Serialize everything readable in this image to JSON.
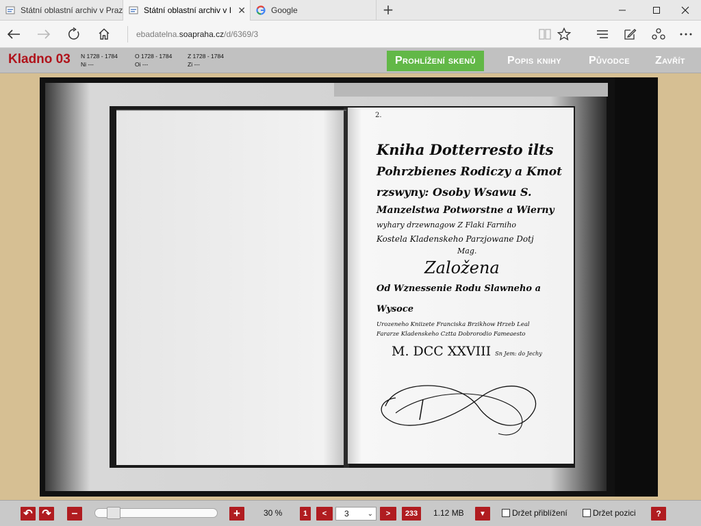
{
  "browser": {
    "tabs": [
      {
        "label": "Státní oblastní archiv v Praz",
        "active": false
      },
      {
        "label": "Státní oblastní archiv v I",
        "active": true
      },
      {
        "label": "Google",
        "active": false
      }
    ],
    "new_tab_symbol": "+",
    "url_prefix": "ebadatelna.",
    "url_host": "soapraha.cz",
    "url_path": "/d/6369/3"
  },
  "header": {
    "title": "Kladno 03",
    "meta": {
      "n": "N 1728 - 1784",
      "ni": "Ni ---",
      "o": "O 1728 - 1784",
      "oi": "Oi ---",
      "z": "Z 1728 - 1784",
      "zi": "Zi ---"
    },
    "menu": [
      {
        "label": "Prohlížení skenů",
        "active": true
      },
      {
        "label": "Popis knihy",
        "active": false
      },
      {
        "label": "Původce",
        "active": false
      },
      {
        "label": "Zavřít",
        "active": false
      }
    ]
  },
  "scan": {
    "page_number": "2.",
    "lines": [
      "Kniha Dotterresto ilts",
      "Pohrzbienes Rodiczy a Kmot",
      "rzswyny: Osoby Wsawu S.",
      "Manzelstwa Potworstne a Wierny",
      "wyhary drzewnagow Z Flaki Farniho",
      "Kostela Kladenskeho Parzjowane Dotj",
      "Mag.",
      "Založena",
      "Od Wznessenie Rodu Slawneho a Wysoce",
      "Urozeneho Kniizete Franciska Brzikhow Hrzeb Leal",
      "Fararze Kladenskeho Cztta Dobrorodio Fameaesto",
      "M. DCC XXVIII",
      "Sn Jem: do Jechy"
    ]
  },
  "toolbar": {
    "undo_symbol": "↶",
    "redo_symbol": "↷",
    "minus": "–",
    "plus": "+",
    "zoom": "30 %",
    "first_page": "1",
    "prev": "<",
    "page_value": "3",
    "next": ">",
    "last_page": "233",
    "file_size": "1.12 MB",
    "download_symbol": "▼",
    "hold_zoom": "Držet přiblížení",
    "hold_position": "Držet pozici",
    "help": "?",
    "zoom_slider_fraction": 0.1
  },
  "colors": {
    "accent_red": "#b01c20",
    "active_menu_green": "#62b847",
    "page_background": "#d6bf93"
  }
}
